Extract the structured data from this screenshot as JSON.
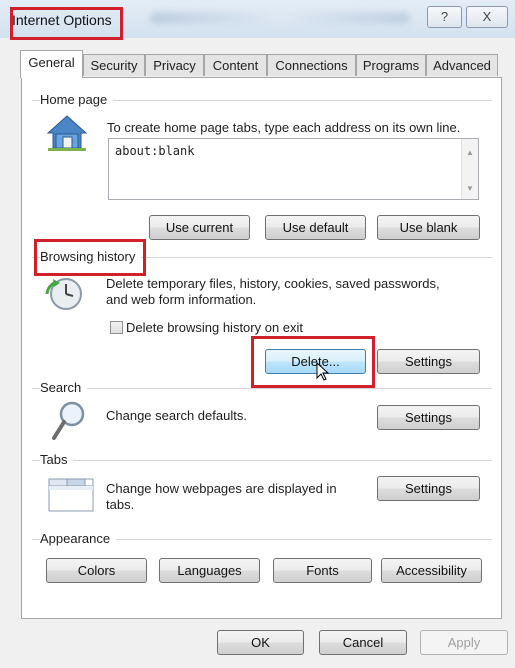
{
  "window": {
    "title": "Internet Options",
    "help_glyph": "?",
    "close_glyph": "X"
  },
  "tabs": [
    "General",
    "Security",
    "Privacy",
    "Content",
    "Connections",
    "Programs",
    "Advanced"
  ],
  "home_page": {
    "label": "Home page",
    "description": "To create home page tabs, type each address on its own line.",
    "value": "about:blank",
    "buttons": [
      "Use current",
      "Use default",
      "Use blank"
    ]
  },
  "browsing_history": {
    "label": "Browsing history",
    "description_line1": "Delete temporary files, history, cookies, saved passwords,",
    "description_line2": "and web form information.",
    "checkbox_label": "Delete browsing history on exit",
    "delete_label": "Delete...",
    "settings_label": "Settings"
  },
  "search": {
    "label": "Search",
    "description": "Change search defaults.",
    "settings_label": "Settings"
  },
  "tabs_group": {
    "label": "Tabs",
    "description_line1": "Change how webpages are displayed in",
    "description_line2": "tabs.",
    "settings_label": "Settings"
  },
  "appearance": {
    "label": "Appearance",
    "buttons": [
      "Colors",
      "Languages",
      "Fonts",
      "Accessibility"
    ]
  },
  "footer": {
    "ok": "OK",
    "cancel": "Cancel",
    "apply": "Apply"
  },
  "colors": {
    "highlight_box": "#d0202a",
    "hover_button": "#bee6fd"
  }
}
